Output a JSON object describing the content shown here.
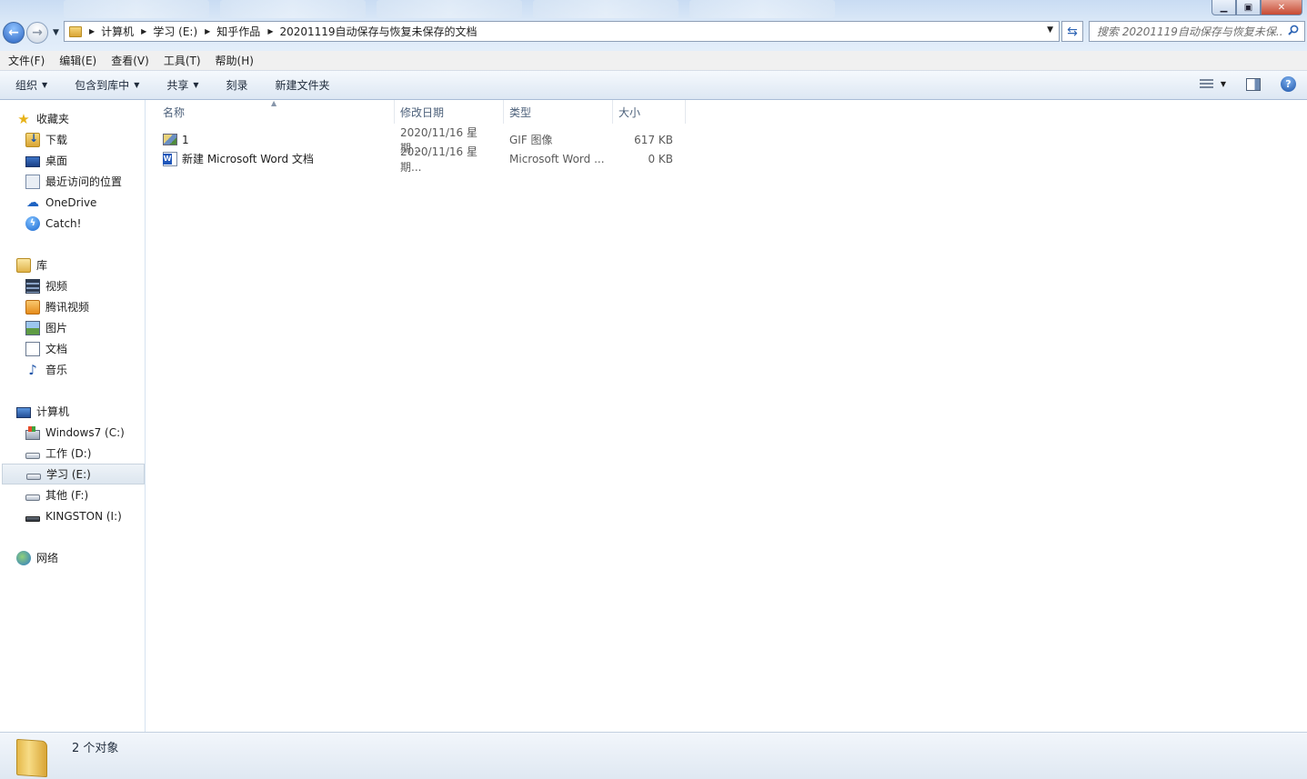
{
  "window": {
    "controls": {
      "minimize": "▁",
      "maximize": "▣",
      "close": "✕"
    }
  },
  "address": {
    "crumbs": [
      "计算机",
      "学习 (E:)",
      "知乎作品",
      "20201119自动保存与恢复未保存的文档"
    ]
  },
  "search": {
    "placeholder": "搜索 20201119自动保存与恢复未保..."
  },
  "menu": [
    "文件(F)",
    "编辑(E)",
    "查看(V)",
    "工具(T)",
    "帮助(H)"
  ],
  "commands": {
    "organize": "组织",
    "include_library": "包含到库中",
    "share": "共享",
    "burn": "刻录",
    "new_folder": "新建文件夹",
    "help_glyph": "?"
  },
  "nav": {
    "favorites": {
      "label": "收藏夹",
      "items": [
        "下载",
        "桌面",
        "最近访问的位置",
        "OneDrive",
        "Catch!"
      ]
    },
    "libraries": {
      "label": "库",
      "items": [
        "视频",
        "腾讯视频",
        "图片",
        "文档",
        "音乐"
      ]
    },
    "computer": {
      "label": "计算机",
      "items": [
        "Windows7 (C:)",
        "工作 (D:)",
        "学习 (E:)",
        "其他 (F:)",
        "KINGSTON (I:)"
      ],
      "selected": "学习 (E:)"
    },
    "network": {
      "label": "网络"
    }
  },
  "columns": {
    "name": "名称",
    "date": "修改日期",
    "type": "类型",
    "size": "大小"
  },
  "files": [
    {
      "name": "1",
      "date": "2020/11/16 星期...",
      "type": "GIF 图像",
      "size": "617 KB",
      "icon": "gif-image-icon"
    },
    {
      "name": "新建 Microsoft Word 文档",
      "date": "2020/11/16 星期...",
      "type": "Microsoft Word ...",
      "size": "0 KB",
      "icon": "word-doc-icon"
    }
  ],
  "status": {
    "count": "2 个对象"
  },
  "colors": {
    "accent": "#2a63c0",
    "header_text": "#4c607a",
    "secondary_text": "#5a5a5a"
  }
}
